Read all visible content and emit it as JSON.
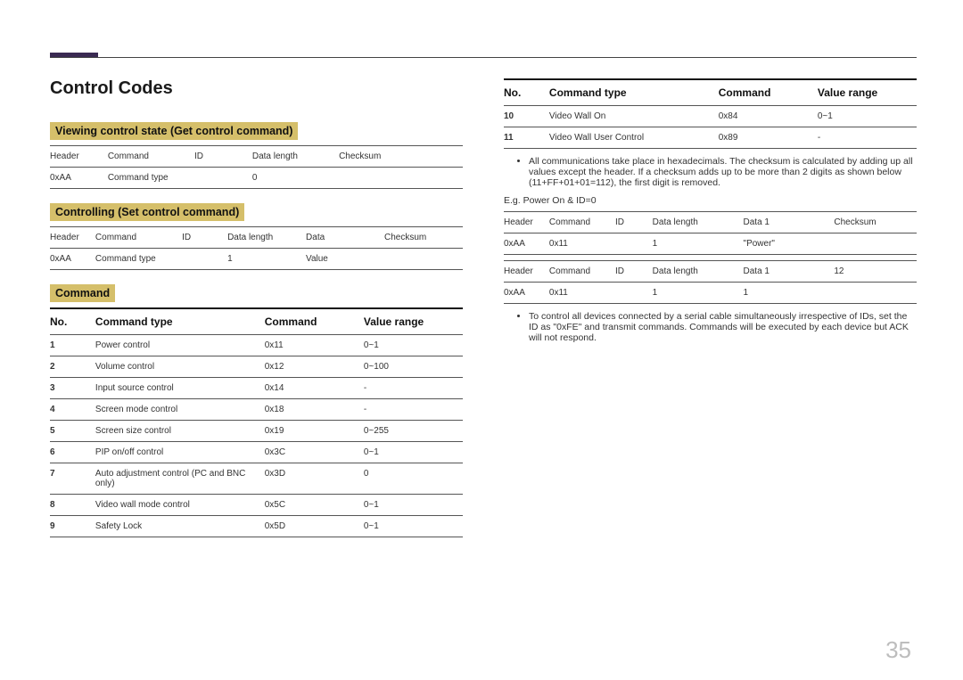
{
  "title": "Control Codes",
  "sub_viewing": "Viewing control state (Get control command)",
  "sub_controlling": "Controlling (Set control command)",
  "sub_command": "Command",
  "tbl_get": {
    "h": [
      "Header",
      "Command",
      "ID",
      "Data length",
      "Checksum"
    ],
    "r": [
      "0xAA",
      "Command type",
      "",
      "0",
      ""
    ]
  },
  "tbl_set": {
    "h": [
      "Header",
      "Command",
      "ID",
      "Data length",
      "Data",
      "Checksum"
    ],
    "r": [
      "0xAA",
      "Command type",
      "",
      "1",
      "Value",
      ""
    ]
  },
  "cmd_head": [
    "No.",
    "Command type",
    "Command",
    "Value range"
  ],
  "cmds_left": [
    {
      "no": "1",
      "type": "Power control",
      "cmd": "0x11",
      "range": "0~1"
    },
    {
      "no": "2",
      "type": "Volume control",
      "cmd": "0x12",
      "range": "0~100"
    },
    {
      "no": "3",
      "type": "Input source control",
      "cmd": "0x14",
      "range": "-"
    },
    {
      "no": "4",
      "type": "Screen mode control",
      "cmd": "0x18",
      "range": "-"
    },
    {
      "no": "5",
      "type": "Screen size control",
      "cmd": "0x19",
      "range": "0~255"
    },
    {
      "no": "6",
      "type": "PIP on/off control",
      "cmd": "0x3C",
      "range": "0~1"
    },
    {
      "no": "7",
      "type": "Auto adjustment control (PC and BNC only)",
      "cmd": "0x3D",
      "range": "0"
    },
    {
      "no": "8",
      "type": "Video wall mode control",
      "cmd": "0x5C",
      "range": "0~1"
    },
    {
      "no": "9",
      "type": "Safety Lock",
      "cmd": "0x5D",
      "range": "0~1"
    }
  ],
  "cmds_right": [
    {
      "no": "10",
      "type": "Video Wall On",
      "cmd": "0x84",
      "range": "0~1"
    },
    {
      "no": "11",
      "type": "Video Wall User Control",
      "cmd": "0x89",
      "range": "-"
    }
  ],
  "bullet1": "All communications take place in hexadecimals. The checksum is calculated by adding up all values except the header. If a checksum adds up to be more than 2 digits as shown below (11+FF+01+01=112), the first digit is removed.",
  "eg_label": "E.g. Power On & ID=0",
  "ex_head1": [
    "Header",
    "Command",
    "ID",
    "Data length",
    "Data 1",
    "Checksum"
  ],
  "ex_row1": [
    "0xAA",
    "0x11",
    "",
    "1",
    "\"Power\"",
    ""
  ],
  "ex_head2": [
    "Header",
    "Command",
    "ID",
    "Data length",
    "Data 1",
    "12"
  ],
  "ex_row2": [
    "0xAA",
    "0x11",
    "",
    "1",
    "1",
    ""
  ],
  "bullet2": "To control all devices connected by a serial cable simultaneously irrespective of IDs, set the ID as \"0xFE\" and transmit commands. Commands will be executed by each device but ACK will not respond.",
  "page_number": "35"
}
